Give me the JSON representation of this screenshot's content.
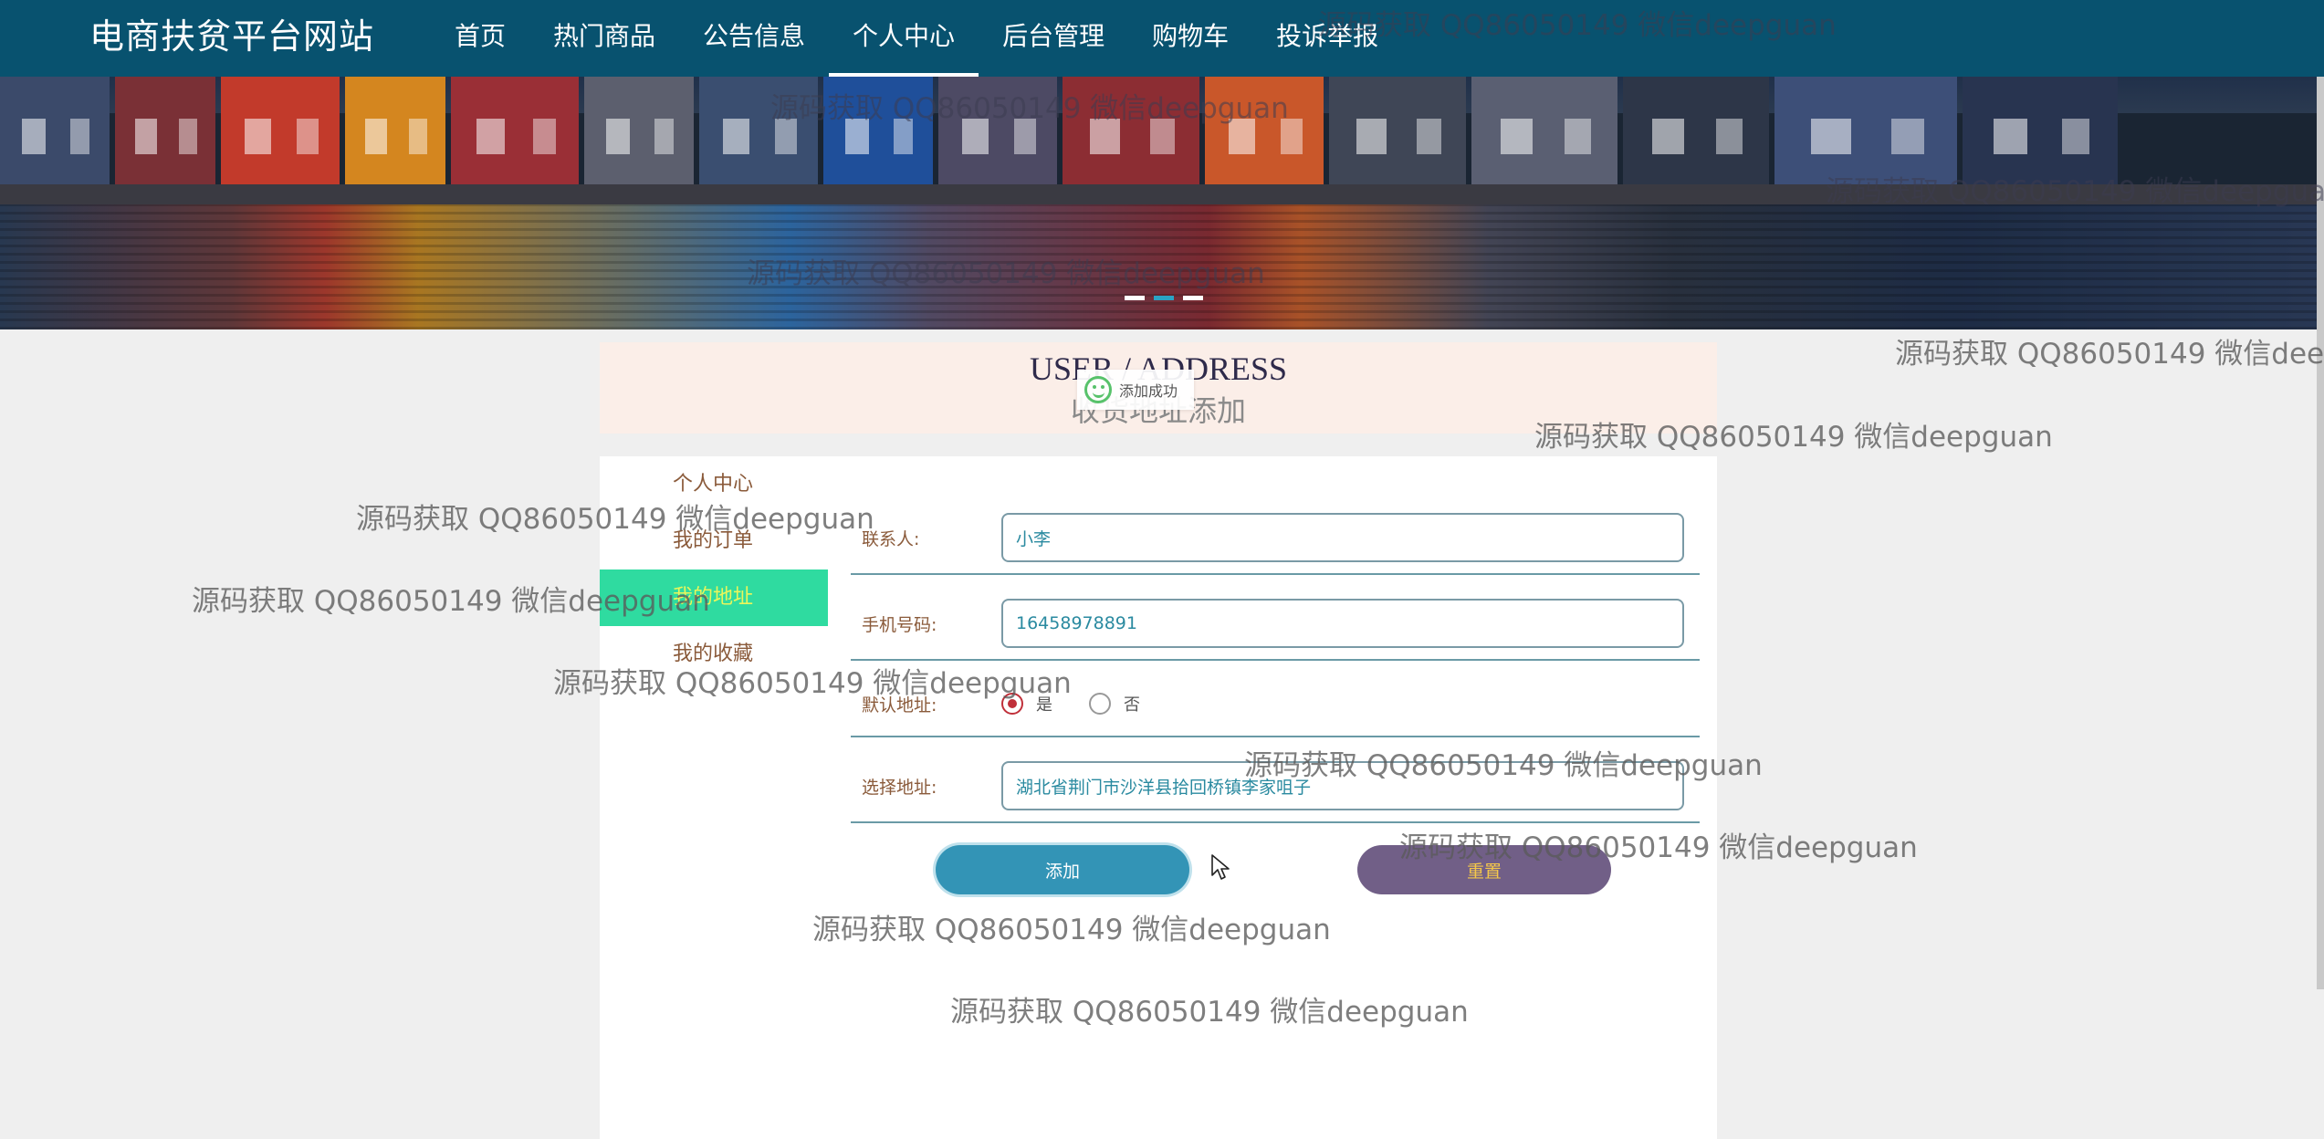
{
  "site": {
    "brand": "电商扶贫平台网站"
  },
  "nav": {
    "items": [
      {
        "label": "首页"
      },
      {
        "label": "热门商品"
      },
      {
        "label": "公告信息"
      },
      {
        "label": "个人中心"
      },
      {
        "label": "后台管理"
      },
      {
        "label": "购物车"
      },
      {
        "label": "投诉举报"
      }
    ],
    "active": "个人中心"
  },
  "header": {
    "title_en": "USER / ADDRESS",
    "title_cn": "收货地址添加"
  },
  "toast": {
    "text": "添加成功",
    "icon": "smile-icon"
  },
  "sidebar": {
    "items": [
      {
        "label": "个人中心"
      },
      {
        "label": "我的订单"
      },
      {
        "label": "我的地址"
      },
      {
        "label": "我的收藏"
      }
    ],
    "active": "我的地址"
  },
  "form": {
    "contact": {
      "label": "联系人:",
      "value": "小李"
    },
    "phone": {
      "label": "手机号码:",
      "value": "16458978891"
    },
    "default": {
      "label": "默认地址:",
      "options": [
        "是",
        "否"
      ],
      "selected": "是"
    },
    "address": {
      "label": "选择地址:",
      "value": "湖北省荆门市沙洋县拾回桥镇李家咀子"
    },
    "add_label": "添加",
    "reset_label": "重置"
  },
  "watermark": "源码获取 QQ86050149 微信deepguan",
  "colors": {
    "nav": "#08526f",
    "accent": "#2fdba0",
    "add": "#3394b6",
    "reset": "#715f87"
  }
}
